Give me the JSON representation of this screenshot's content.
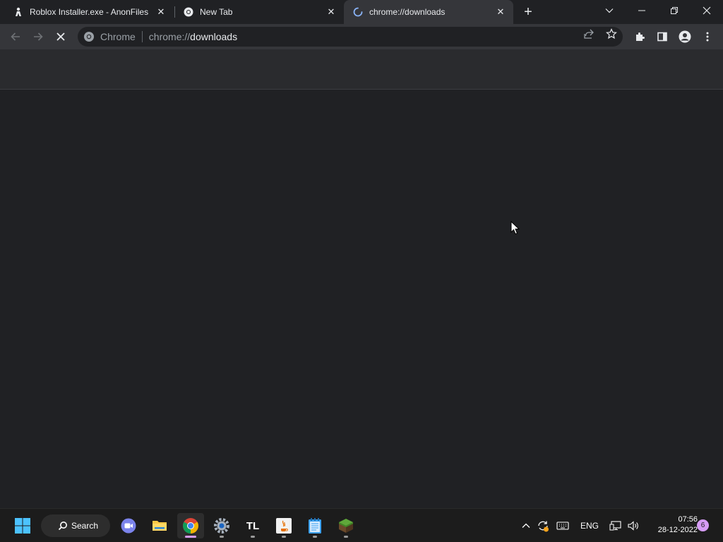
{
  "tabs": [
    {
      "title": "Roblox Installer.exe - AnonFiles",
      "icon": "anonfiles-icon",
      "active": false
    },
    {
      "title": "New Tab",
      "icon": "chrome-icon",
      "active": false
    },
    {
      "title": "chrome://downloads",
      "icon": "loading-spinner-icon",
      "active": true
    }
  ],
  "omnibox": {
    "chip": "Chrome",
    "url_scheme": "chrome://",
    "url_path": "downloads"
  },
  "taskbar": {
    "search_label": "Search",
    "apps": [
      "start",
      "search",
      "meet",
      "file-explorer",
      "chrome",
      "settings",
      "tlauncher",
      "java",
      "notepad",
      "minecraft"
    ]
  },
  "tray": {
    "language": "ENG",
    "time": "07:56",
    "date": "28-12-2022",
    "notifications": "6"
  },
  "colors": {
    "background": "#202124",
    "toolbar": "#35363a",
    "accent": "#d69cf5"
  }
}
